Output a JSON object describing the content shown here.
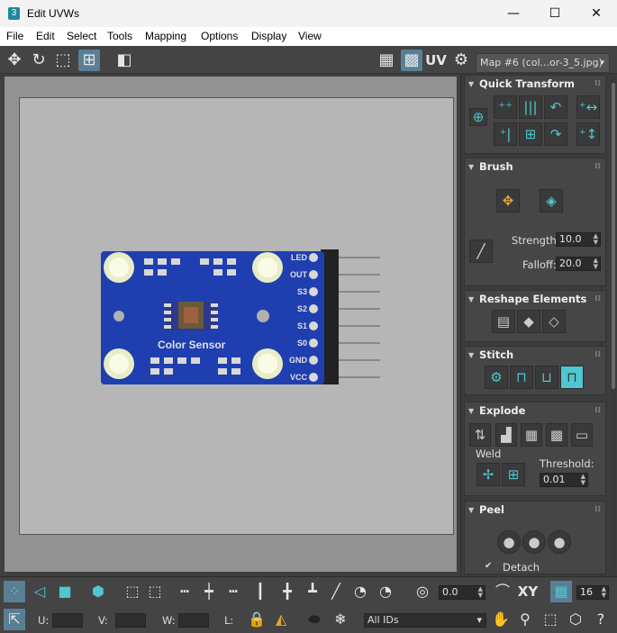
{
  "window": {
    "title": "Edit UVWs",
    "app_icon": "3",
    "minimize_glyph": "—",
    "maximize_glyph": "☐",
    "close_glyph": "✕"
  },
  "menu": [
    "File",
    "Edit",
    "Select",
    "Tools",
    "Mapping",
    "Options",
    "Display",
    "View"
  ],
  "toolbar": {
    "uv_label": "UV",
    "map_selector": "Map #6 (col...or-3_5.jpg)",
    "move_icon": "✥",
    "rotate_icon": "↻",
    "scale_icon": "⬚",
    "freeform_icon": "⊞",
    "mirror_icon": "◧",
    "checker_icon": "▦",
    "checker2_icon": "▩",
    "settings_icon": "⚙"
  },
  "image": {
    "board_text": "Color Sensor",
    "pin_labels": [
      "LED",
      "OUT",
      "S3",
      "S2",
      "S1",
      "S0",
      "GND",
      "VCC"
    ]
  },
  "panel": {
    "quick_transform": {
      "title": "Quick Transform",
      "icons": [
        "⊕",
        "⁺⁺",
        "|||",
        "↶",
        "⁺↔",
        "⁺|",
        "⊞",
        "↷",
        "⁺↕"
      ]
    },
    "brush": {
      "title": "Brush",
      "strength_label": "Strength:",
      "strength_value": "10.0",
      "falloff_label": "Falloff:",
      "falloff_value": "20.0"
    },
    "reshape": {
      "title": "Reshape Elements"
    },
    "stitch": {
      "title": "Stitch"
    },
    "explode": {
      "title": "Explode",
      "weld_label": "Weld",
      "threshold_label": "Threshold:",
      "threshold_value": "0.01"
    },
    "peel": {
      "title": "Peel",
      "detach_label": "Detach",
      "detach_check": "✔"
    }
  },
  "bottom": {
    "rotate_value": "0.0",
    "xy_label": "XY",
    "grid_value": "16",
    "u_label": "U:",
    "v_label": "V:",
    "w_label": "W:",
    "l_label": "L:",
    "ids_value": "All IDs",
    "snowflake_icon": "❄",
    "hand_icon": "✋",
    "zoom_icon": "⚲",
    "help_icon": "?",
    "lock_icon": "🔒",
    "dropdown_arrow": "▾",
    "up_arrow": "▴",
    "down_arrow": "▾"
  },
  "accent_color": "#4fc7d1",
  "pcb_color": "#1f3fb0"
}
